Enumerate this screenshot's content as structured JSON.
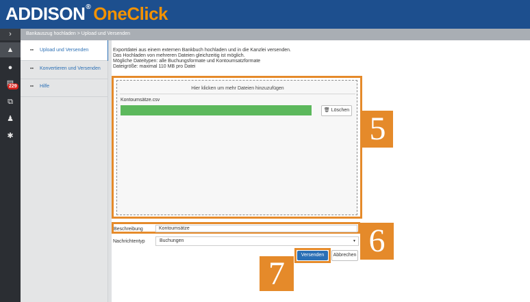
{
  "app": {
    "brand_part1": "ADDISON",
    "brand_reg": "®",
    "brand_part2": "OneClick",
    "colors": {
      "header": "#1d4f8e",
      "accent": "#f39200",
      "marker": "#e58a2a",
      "primary_button": "#2a6fb5",
      "progress": "#5cb85c",
      "badge": "#d9231d"
    }
  },
  "rail": {
    "items": [
      {
        "icon": "chevron-right-icon",
        "glyph": "›"
      },
      {
        "icon": "chart-icon",
        "glyph": "▲"
      },
      {
        "icon": "chat-icon",
        "glyph": "●"
      },
      {
        "icon": "document-icon",
        "glyph": "▤",
        "badge": "229"
      },
      {
        "icon": "copy-icon",
        "glyph": "⧉"
      },
      {
        "icon": "person-icon",
        "glyph": "♟"
      },
      {
        "icon": "gear-icon",
        "glyph": "✱"
      }
    ]
  },
  "breadcrumb": "Bankauszug hochladen > Upload und Versenden",
  "sidebar": {
    "items": [
      {
        "label": "Upload und Versenden",
        "icon": "grid-icon",
        "glyph": "▪▪"
      },
      {
        "label": "Konvertieren und Versenden",
        "icon": "grid-icon",
        "glyph": "▪▪"
      },
      {
        "label": "Hilfe",
        "icon": "grid-icon",
        "glyph": "▪▪"
      }
    ]
  },
  "info": {
    "line1": "Exportdatei aus einem externen Bankbuch hochladen und in die Kanzlei versenden.",
    "line2": "Das Hochladen von mehreren Dateien gleichzeitig ist möglich.",
    "line3": "Mögliche Dateitypen: alle Buchungsformate und Kontoumsatzformate",
    "line4": "Dateigröße: maximal 110 MB pro Datei"
  },
  "upload": {
    "dropzone_text": "Hier klicken um mehr Dateien hinzuzufügen",
    "file_name": "Kontoumsätze.csv",
    "progress_percent": 100,
    "delete_label": "Löschen",
    "delete_icon": "trash-icon"
  },
  "form": {
    "description_label": "Beschreibung",
    "description_value": "Kontoumsätze",
    "message_type_label": "Nachrichtentyp",
    "message_type_value": "Buchungen"
  },
  "buttons": {
    "send": "Versenden",
    "cancel": "Abbrechen"
  },
  "markers": {
    "m5": "5",
    "m6": "6",
    "m7": "7"
  }
}
